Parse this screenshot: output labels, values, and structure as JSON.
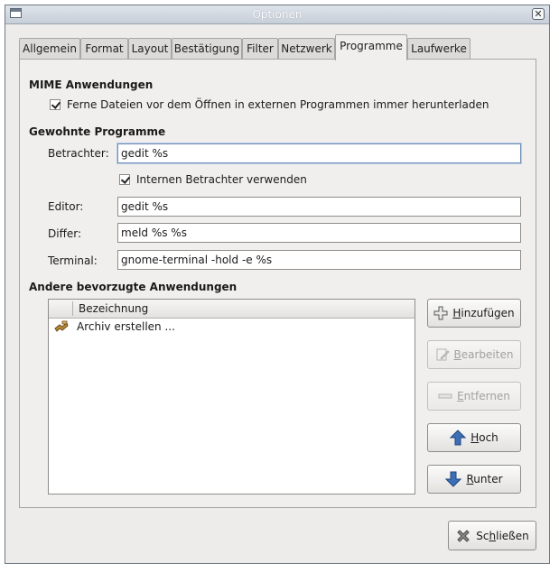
{
  "window": {
    "title": "Optionen"
  },
  "tabs": [
    {
      "label": "Allgemein"
    },
    {
      "label": "Format"
    },
    {
      "label": "Layout"
    },
    {
      "label": "Bestätigung"
    },
    {
      "label": "Filter"
    },
    {
      "label": "Netzwerk"
    },
    {
      "label": "Programme",
      "active": true
    },
    {
      "label": "Laufwerke"
    }
  ],
  "mime": {
    "heading": "MIME Anwendungen",
    "download_label": "Ferne Dateien vor dem Öffnen in externen Programmen immer herunterladen",
    "download_checked": true
  },
  "programs": {
    "heading": "Gewohnte Programme",
    "viewer_label": "Betrachter:",
    "viewer_value": "gedit %s",
    "internal_viewer_label": "Internen Betrachter verwenden",
    "internal_viewer_checked": true,
    "editor_label": "Editor:",
    "editor_value": "gedit %s",
    "differ_label": "Differ:",
    "differ_value": "meld %s %s",
    "terminal_label": "Terminal:",
    "terminal_value": "gnome-terminal -hold -e %s"
  },
  "other": {
    "heading": "Andere bevorzugte Anwendungen",
    "column_header": "Bezeichnung",
    "items": [
      {
        "label": "Archiv erstellen ..."
      }
    ]
  },
  "buttons": {
    "add": {
      "accel": "H",
      "rest": "inzufügen",
      "icon": "plus-icon"
    },
    "edit": {
      "accel": "B",
      "rest": "earbeiten",
      "icon": "edit-icon",
      "disabled": true
    },
    "remove": {
      "accel": "E",
      "rest": "ntfernen",
      "icon": "minus-icon",
      "disabled": true
    },
    "up": {
      "accel": "H",
      "rest": "och",
      "icon": "arrow-up-icon"
    },
    "down": {
      "accel": "R",
      "rest": "unter",
      "icon": "arrow-down-icon"
    },
    "close": {
      "pre": "Sc",
      "accel": "h",
      "rest": "ließen",
      "icon": "close-x-icon"
    }
  },
  "colors": {
    "accent_blue": "#3c6fb5",
    "disabled_text": "#a3a19e"
  }
}
